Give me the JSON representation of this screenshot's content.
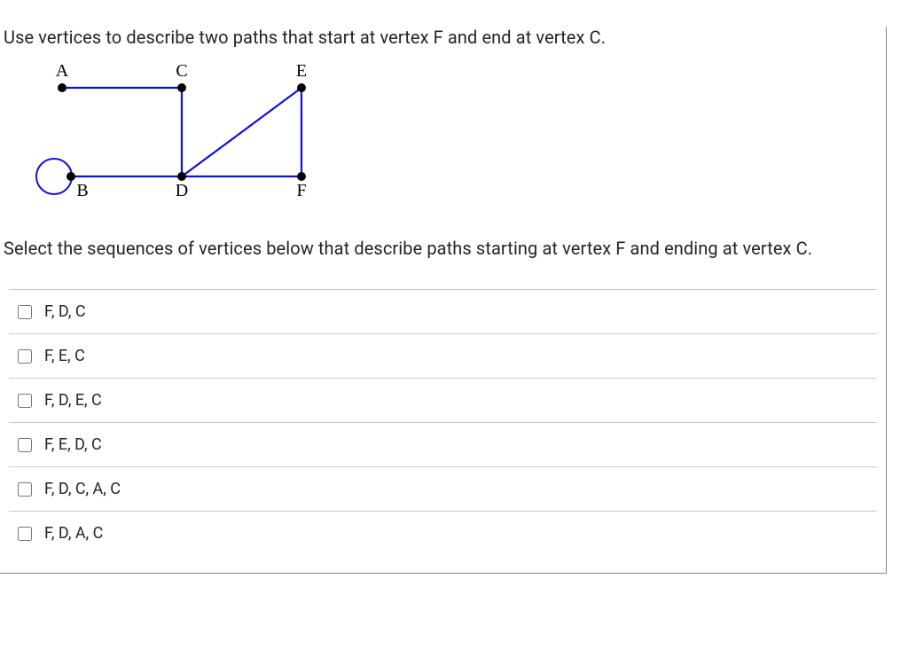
{
  "question": {
    "prompt": "Use vertices to describe two paths that start at vertex F and end at vertex C.",
    "instruction": "Select the sequences of vertices below that describe paths starting at vertex F and ending at vertex C."
  },
  "graph": {
    "vertices": {
      "A": "A",
      "B": "B",
      "C": "C",
      "D": "D",
      "E": "E",
      "F": "F"
    }
  },
  "options": [
    {
      "label": "F, D, C"
    },
    {
      "label": "F, E, C"
    },
    {
      "label": "F, D, E, C"
    },
    {
      "label": "F, E, D, C"
    },
    {
      "label": "F, D, C, A, C"
    },
    {
      "label": "F, D, A, C"
    }
  ]
}
